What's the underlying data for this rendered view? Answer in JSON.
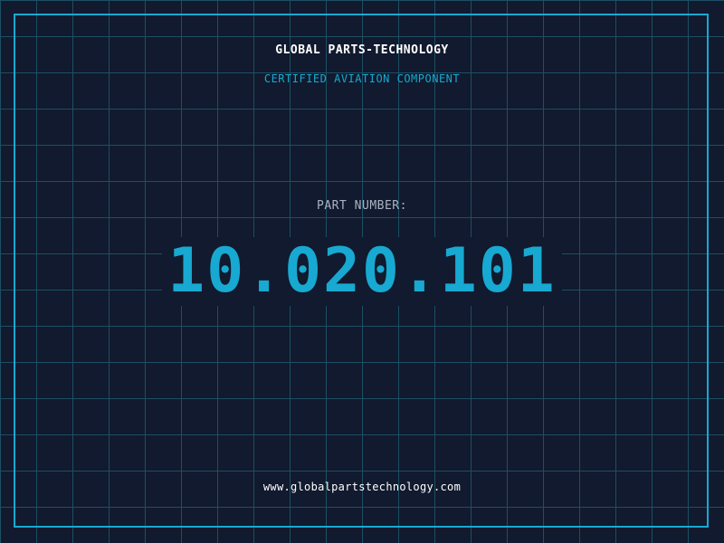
{
  "header": {
    "company_name": "GLOBAL PARTS-TECHNOLOGY",
    "subtitle": "CERTIFIED AVIATION COMPONENT"
  },
  "main": {
    "part_label": "PART NUMBER:",
    "part_number": "10.020.101"
  },
  "footer": {
    "website": "www.globalpartstechnology.com"
  },
  "colors": {
    "background": "#111a2e",
    "grid": "#1d4f63",
    "accent": "#17a9d1",
    "primary_text": "#ffffff",
    "muted_text": "#a8b3c2"
  }
}
